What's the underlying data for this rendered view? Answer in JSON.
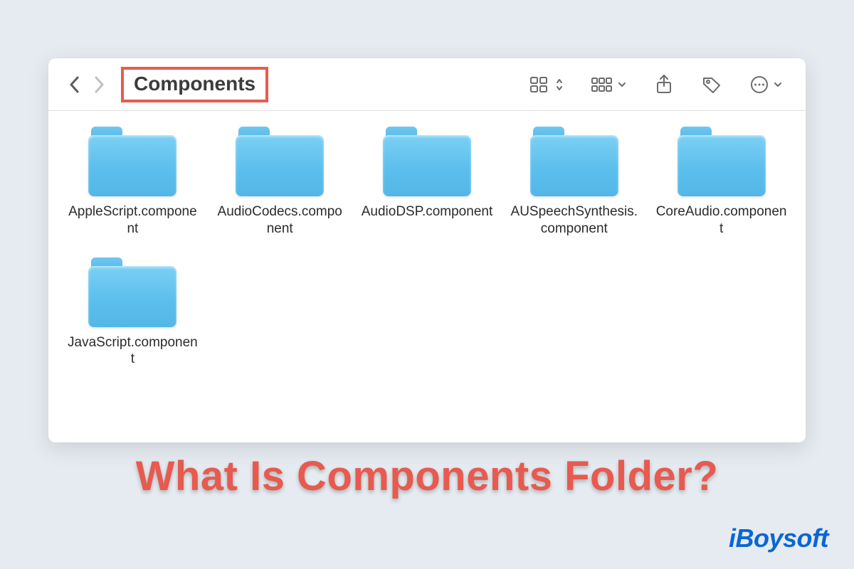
{
  "toolbar": {
    "title": "Components"
  },
  "files": [
    {
      "name": "AppleScript.component"
    },
    {
      "name": "AudioCodecs.component"
    },
    {
      "name": "AudioDSP.component"
    },
    {
      "name": "AUSpeechSynthesis.component"
    },
    {
      "name": "CoreAudio.component"
    },
    {
      "name": "JavaScript.component"
    }
  ],
  "caption": "What Is Components Folder?",
  "watermark": "iBoysoft"
}
